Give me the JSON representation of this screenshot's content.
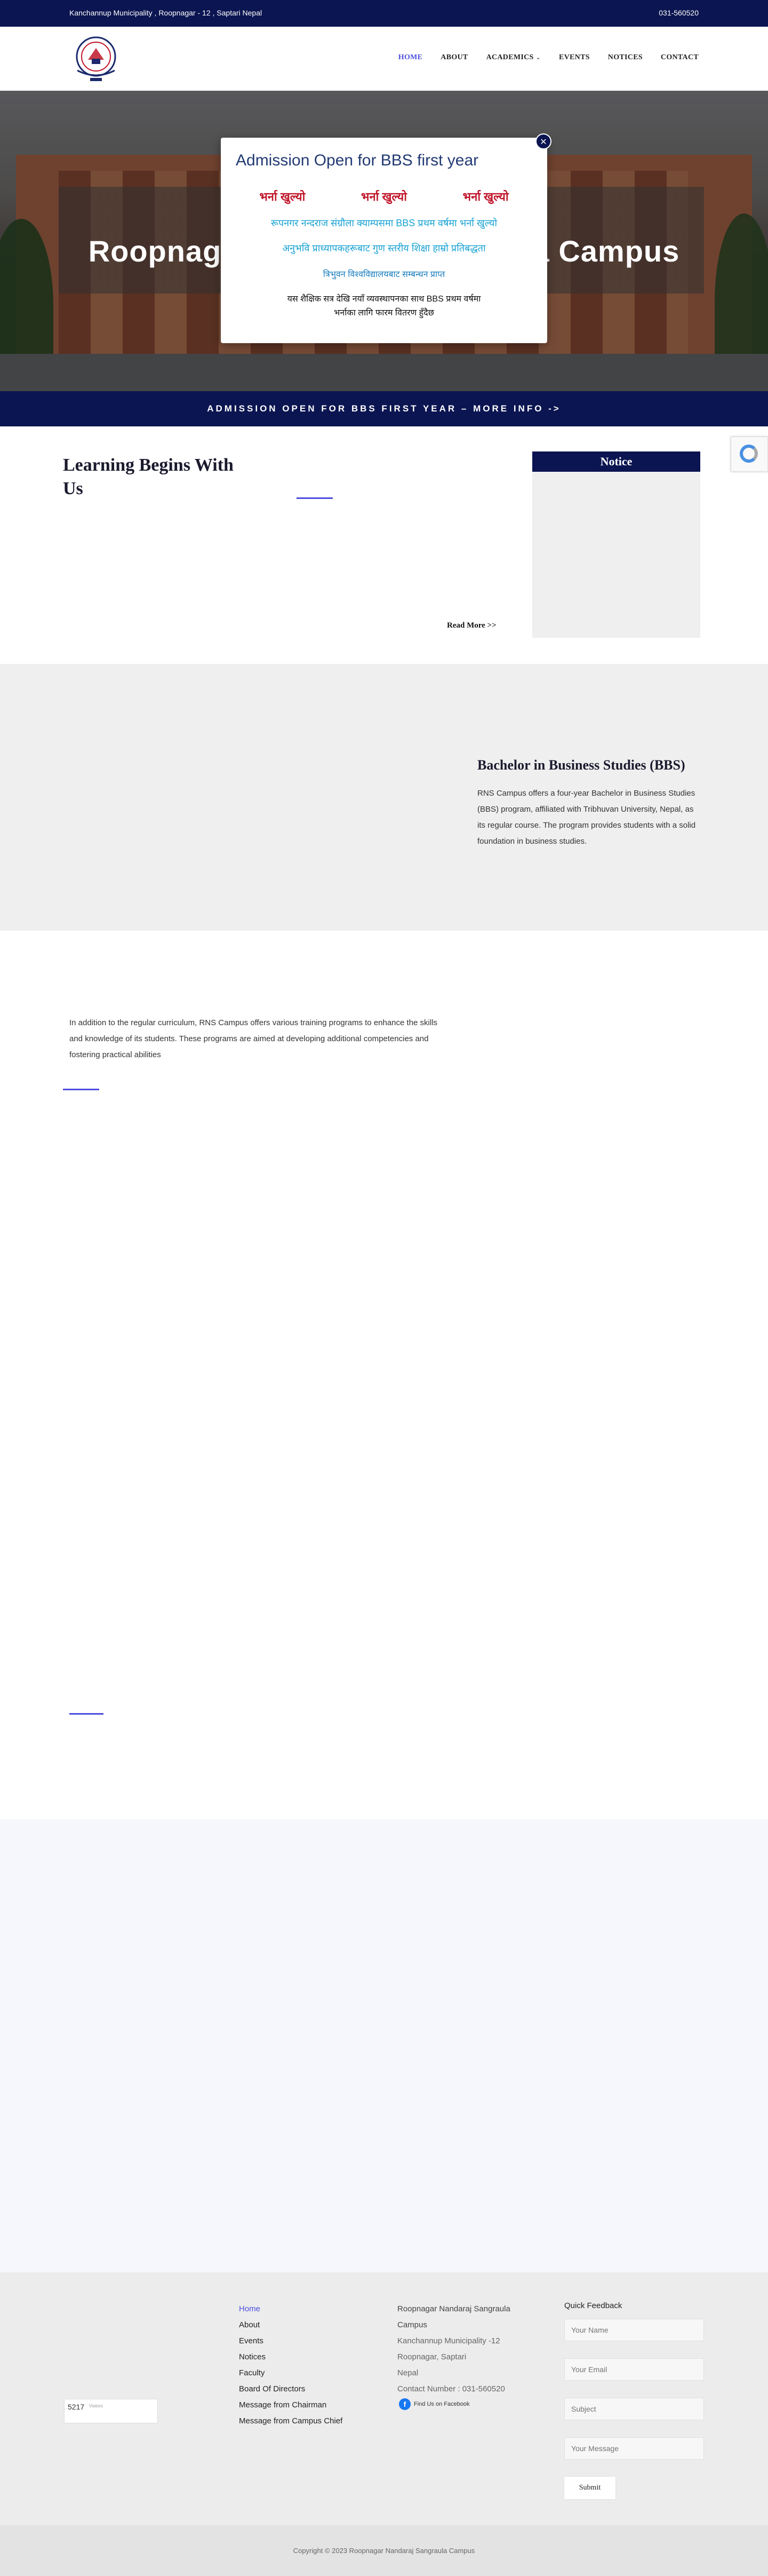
{
  "topbar": {
    "address": "Kanchannup Municipality , Roopnagar - 12 , Saptari Nepal",
    "phone": "031-560520"
  },
  "nav": {
    "items": [
      "HOME",
      "ABOUT",
      "ACADEMICS",
      "EVENTS",
      "NOTICES",
      "CONTACT"
    ],
    "active": "HOME",
    "academics_dropdown_icon": "chevron-down-icon"
  },
  "hero": {
    "title": "Roopnagar Nandaraj Sangraula Campus"
  },
  "ticker": {
    "text": "ADMISSION OPEN FOR BBS FIRST YEAR – MORE INFO ->"
  },
  "modal": {
    "title": "Admission Open for BBS first year",
    "red_labels": [
      "भर्ना खुल्यो",
      "भर्ना खुल्यो",
      "भर्ना खुल्यो"
    ],
    "line1": "रूपनगर नन्दराज संग्रौला क्याम्पसमा BBS प्रथम वर्षमा भर्ना खुल्यो",
    "line2": "अनुभवि प्राध्यापकहरूबाट गुण स्तरीय शिक्षा हाम्रो प्रतिबद्धता",
    "line3": "त्रिभुवन विश्वविद्यालयबाट सम्बन्धन प्राप्त",
    "line4": "यस शैक्षिक सत्र देखि नयाँ व्यवस्थापनका साथ BBS प्रथम वर्षमा",
    "line5": "भर्नाका लागि फारम वितरण हुँदैछ",
    "close_icon": "close-icon"
  },
  "learning": {
    "title": "Learning Begins With Us",
    "read_more": "Read More >>"
  },
  "notice": {
    "title": "Notice"
  },
  "bbs": {
    "title": "Bachelor in Business Studies (BBS)",
    "description": "RNS Campus offers a four-year Bachelor in Business Studies (BBS) program, affiliated with Tribhuvan University, Nepal, as its regular course. The program provides students with a solid foundation in business studies."
  },
  "training": {
    "description": "In addition to the regular curriculum, RNS Campus offers various training programs to enhance the skills and knowledge of its students. These programs are aimed at developing additional competencies and fostering practical abilities"
  },
  "footer": {
    "counter_value": "5217",
    "counter_label": "Visitors",
    "links": [
      "Home",
      "About",
      "Events",
      "Notices",
      "Faculty",
      "Board Of Directors",
      "Message from Chairman",
      "Message from Campus Chief"
    ],
    "active_link": "Home",
    "contact": {
      "name": "Roopnagar Nandaraj Sangraula Campus",
      "address_line1": "Kanchannup Municipality -12",
      "address_line2": "Roopnagar, Saptari",
      "country": "Nepal",
      "contact": "Contact Number : 031-560520"
    },
    "facebook_label": "Find Us on Facebook",
    "quick_feedback": {
      "title": "Quick Feedback",
      "name_placeholder": "Your Name",
      "email_placeholder": "Your Email",
      "subject_placeholder": "Subject",
      "message_placeholder": "Your Message",
      "submit_label": "Submit"
    }
  },
  "copyright": "Copyright © 2023 Roopnagar Nandaraj Sangraula Campus",
  "colors": {
    "navy": "#0b1551",
    "accent": "#4d4ee0",
    "hindi_red": "#c0162a",
    "hindi_cyan": "#1aa3d4"
  }
}
